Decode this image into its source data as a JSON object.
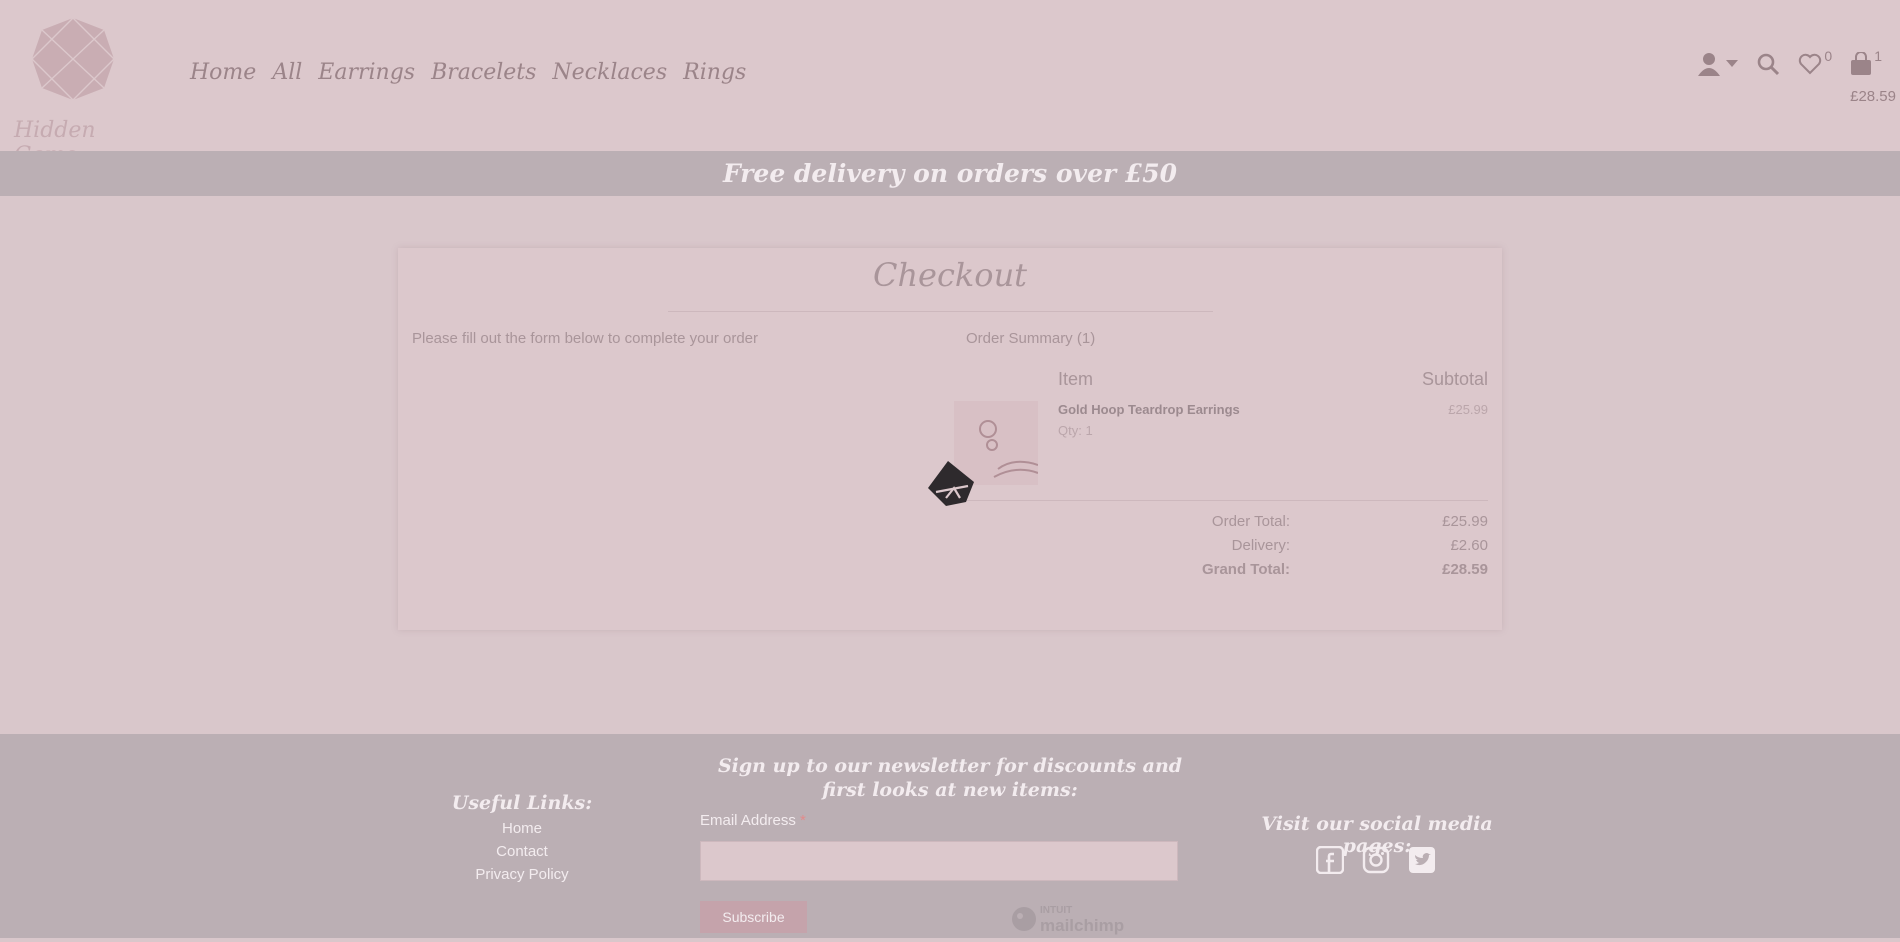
{
  "header": {
    "logo_text": "Hidden Gems",
    "nav": [
      "Home",
      "All",
      "Earrings",
      "Bracelets",
      "Necklaces",
      "Rings"
    ],
    "wishlist_count": "0",
    "cart_count": "1",
    "cart_total": "£28.59",
    "icons": [
      "user-icon",
      "caret-down-icon",
      "search-icon",
      "heart-icon",
      "shopping-bag-icon"
    ]
  },
  "banner": {
    "text": "Free delivery on orders over £50"
  },
  "checkout": {
    "title": "Checkout",
    "form_hint": "Please fill out the form below to complete your order",
    "summary_label": "Order Summary (1)",
    "col_item": "Item",
    "col_subtotal": "Subtotal",
    "product": {
      "name": "Gold Hoop Teardrop Earrings",
      "qty": "Qty: 1",
      "price": "£25.99"
    },
    "totals": {
      "order_label": "Order Total:",
      "order_value": "£25.99",
      "delivery_label": "Delivery:",
      "delivery_value": "£2.60",
      "grand_label": "Grand Total:",
      "grand_value": "£28.59"
    }
  },
  "footer": {
    "useful_heading": "Useful Links:",
    "links": [
      "Home",
      "Contact",
      "Privacy Policy"
    ],
    "newsletter_title": "Sign up to our newsletter for discounts and first looks at new items:",
    "email_label": "Email Address",
    "email_required": "*",
    "subscribe_label": "Subscribe",
    "mailchimp_top": "INTUIT",
    "mailchimp_bottom": "mailchimp",
    "social_heading": "Visit our social media pages:",
    "social_icons": [
      "facebook-icon",
      "instagram-icon",
      "twitter-icon"
    ]
  },
  "colors": {
    "overlay_bg": "#d9c7cb",
    "banner_bg": "#bbafb4",
    "text_muted": "#a9959a",
    "subscribe_bg": "#c5a3ab"
  }
}
